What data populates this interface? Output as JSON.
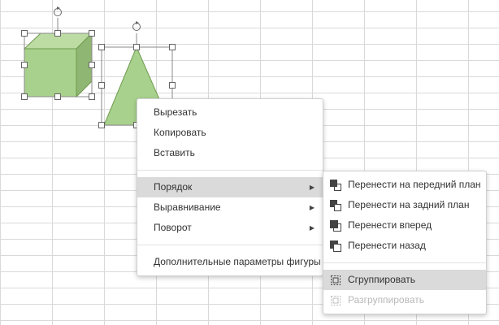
{
  "context_menu": {
    "items": [
      {
        "label": "Вырезать"
      },
      {
        "label": "Копировать"
      },
      {
        "label": "Вставить"
      },
      {
        "label": "Порядок",
        "has_submenu": true,
        "highlighted": true
      },
      {
        "label": "Выравнивание",
        "has_submenu": true
      },
      {
        "label": "Поворот",
        "has_submenu": true
      },
      {
        "label": "Дополнительные параметры фигуры"
      }
    ]
  },
  "submenu": {
    "items": [
      {
        "label": "Перенести на передний план",
        "icon": "bring-to-front-icon"
      },
      {
        "label": "Перенести на задний план",
        "icon": "send-to-back-icon"
      },
      {
        "label": "Перенести вперед",
        "icon": "bring-forward-icon"
      },
      {
        "label": "Перенести назад",
        "icon": "send-backward-icon"
      },
      {
        "label": "Сгруппировать",
        "icon": "group-icon",
        "highlighted": true
      },
      {
        "label": "Разгруппировать",
        "icon": "ungroup-icon",
        "disabled": true
      }
    ]
  },
  "colors": {
    "shape_fill": "#a9d18e",
    "shape_fill_dark": "#8fb672",
    "shape_stroke": "#6e9a4c",
    "highlight": "#dadada",
    "grid_line": "#d9d9d9"
  }
}
